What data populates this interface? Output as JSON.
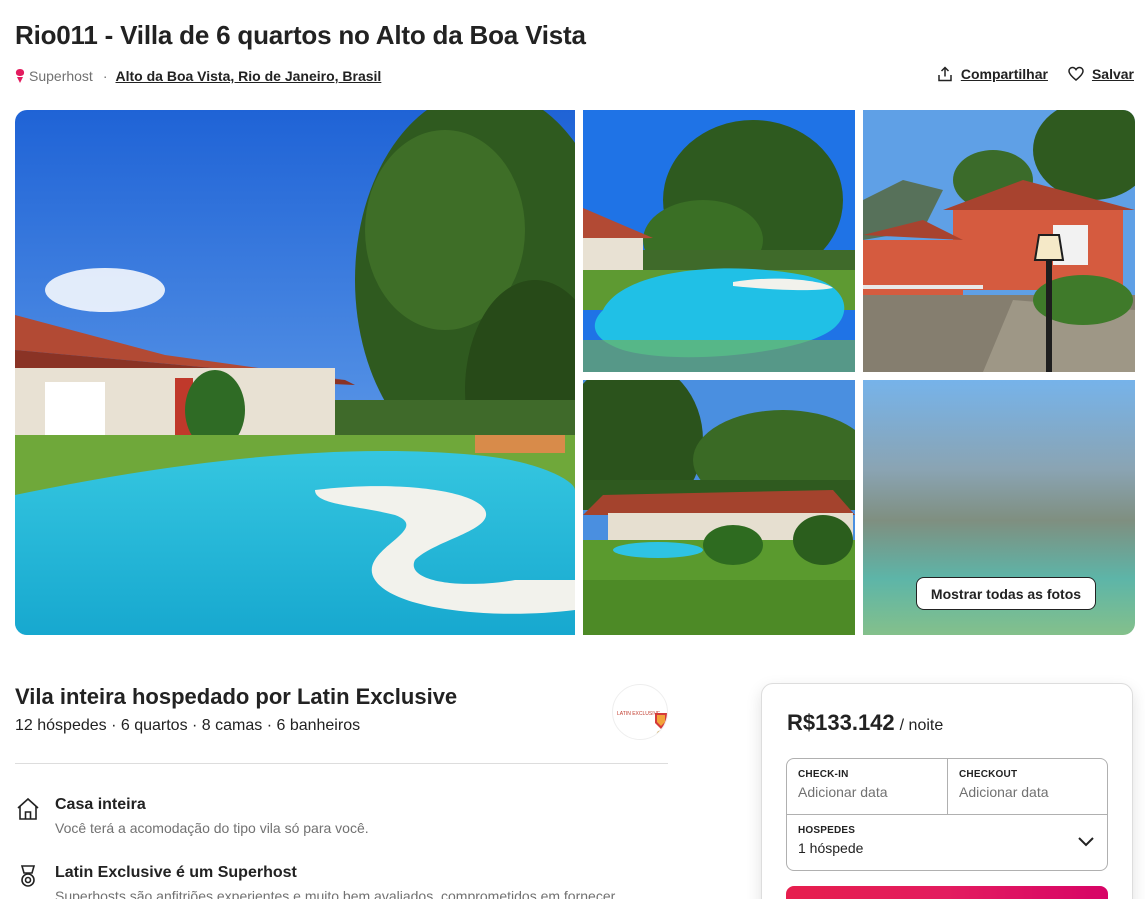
{
  "listing": {
    "title": "Rio011 - Villa de 6 quartos no Alto da Boa Vista",
    "superhost_label": "Superhost",
    "separator": "·",
    "location": "Alto da Boa Vista, Rio de Janeiro, Brasil",
    "share_label": "Compartilhar",
    "save_label": "Salvar"
  },
  "gallery": {
    "show_all_label": "Mostrar todas as fotos",
    "photos": [
      "pool-main-photo",
      "pool-tree-photo",
      "house-lamp-photo",
      "house-garden-photo",
      "blurred-photo"
    ]
  },
  "host": {
    "title": "Vila inteira hospedado por Latin Exclusive",
    "summary": "12 hóspedes · 6 quartos · 8 camas · 6 banheiros",
    "logo_text": "LATIN EXCLUSIVE"
  },
  "features": [
    {
      "icon": "home-icon",
      "title": "Casa inteira",
      "desc": "Você terá a acomodação do tipo vila só para você."
    },
    {
      "icon": "superhost-medal-icon",
      "title": "Latin Exclusive é um Superhost",
      "desc": "Superhosts são anfitriões experientes e muito bem avaliados, comprometidos em fornecer"
    }
  ],
  "booking": {
    "price": "R$133.142",
    "unit": "/ noite",
    "checkin_label": "CHECK-IN",
    "checkin_value": "Adicionar data",
    "checkout_label": "CHECKOUT",
    "checkout_value": "Adicionar data",
    "guests_label": "HOSPEDES",
    "guests_value": "1 hóspede"
  },
  "colors": {
    "brand": "#e31c5f",
    "text": "#222222",
    "muted": "#717171",
    "border": "#dddddd"
  }
}
